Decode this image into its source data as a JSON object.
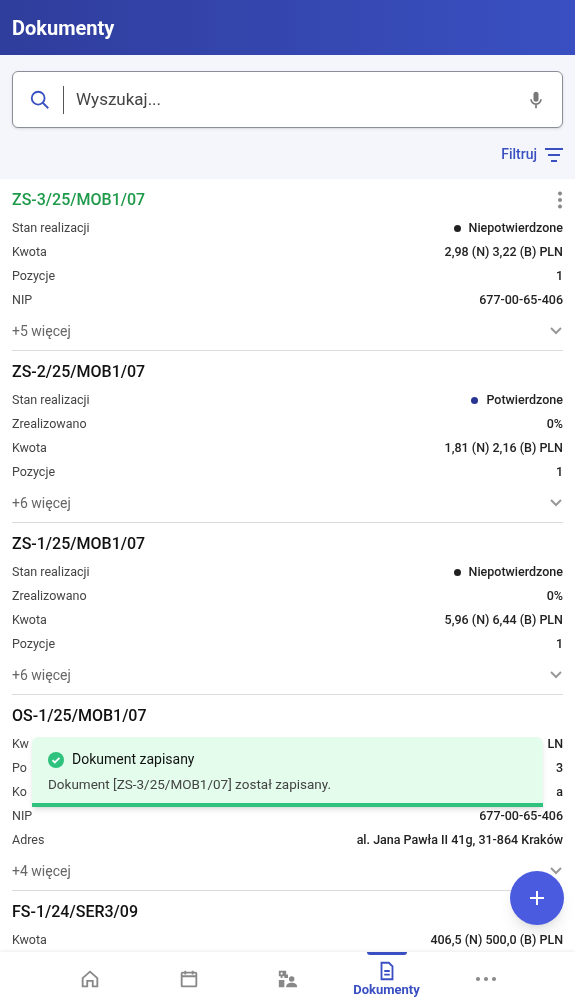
{
  "app_bar": {
    "title": "Dokumenty"
  },
  "search": {
    "placeholder": "Wyszukaj..."
  },
  "filter": {
    "label": "Filtruj"
  },
  "documents": [
    {
      "title": "ZS-3/25/MOB1/07",
      "highlighted": true,
      "menu": true,
      "rows": [
        {
          "label": "Stan realizacji",
          "value": "Niepotwierdzone",
          "color": "#212121"
        },
        {
          "label": "Kwota",
          "value": "2,98 (N) 3,22 (B) PLN"
        },
        {
          "label": "Pozycje",
          "value": "1"
        },
        {
          "label": "NIP",
          "value": "677-00-65-406"
        }
      ],
      "more": "+5 więcej"
    },
    {
      "title": "ZS-2/25/MOB1/07",
      "highlighted": false,
      "menu": false,
      "rows": [
        {
          "label": "Stan realizacji",
          "value": "Potwierdzone",
          "color": "#283593"
        },
        {
          "label": "Zrealizowano",
          "value": "0%"
        },
        {
          "label": "Kwota",
          "value": "1,81 (N) 2,16 (B) PLN"
        },
        {
          "label": "Pozycje",
          "value": "1"
        }
      ],
      "more": "+6 więcej"
    },
    {
      "title": "ZS-1/25/MOB1/07",
      "highlighted": false,
      "menu": false,
      "rows": [
        {
          "label": "Stan realizacji",
          "value": "Niepotwierdzone",
          "color": "#212121"
        },
        {
          "label": "Zrealizowano",
          "value": "0%"
        },
        {
          "label": "Kwota",
          "value": "5,96 (N) 6,44 (B) PLN"
        },
        {
          "label": "Pozycje",
          "value": "1"
        }
      ],
      "more": "+6 więcej"
    },
    {
      "title": "OS-1/25/MOB1/07",
      "highlighted": false,
      "menu": false,
      "rows": [
        {
          "label": "Kw",
          "value": "LN"
        },
        {
          "label": "Po",
          "value": "3"
        },
        {
          "label": "Ko",
          "value": "a"
        },
        {
          "label": "NIP",
          "value": "677-00-65-406"
        },
        {
          "label": "Adres",
          "value": "al. Jana Pawła II 41g, 31-864 Kraków"
        }
      ],
      "more": "+4 więcej"
    },
    {
      "title": "FS-1/24/SER3/09",
      "highlighted": false,
      "menu": false,
      "rows": [
        {
          "label": "Kwota",
          "value": "406,5 (N) 500,0 (B) PLN"
        }
      ]
    }
  ],
  "toast": {
    "title": "Dokument zapisany",
    "message": "Dokument [ZS-3/25/MOB1/07] został zapisany."
  },
  "bottom_nav": [
    {
      "kind": "home",
      "selected": false
    },
    {
      "kind": "calendar",
      "selected": false
    },
    {
      "kind": "contacts",
      "selected": false
    },
    {
      "kind": "documents",
      "label": "Dokumenty",
      "selected": true
    },
    {
      "kind": "more",
      "selected": false
    }
  ]
}
